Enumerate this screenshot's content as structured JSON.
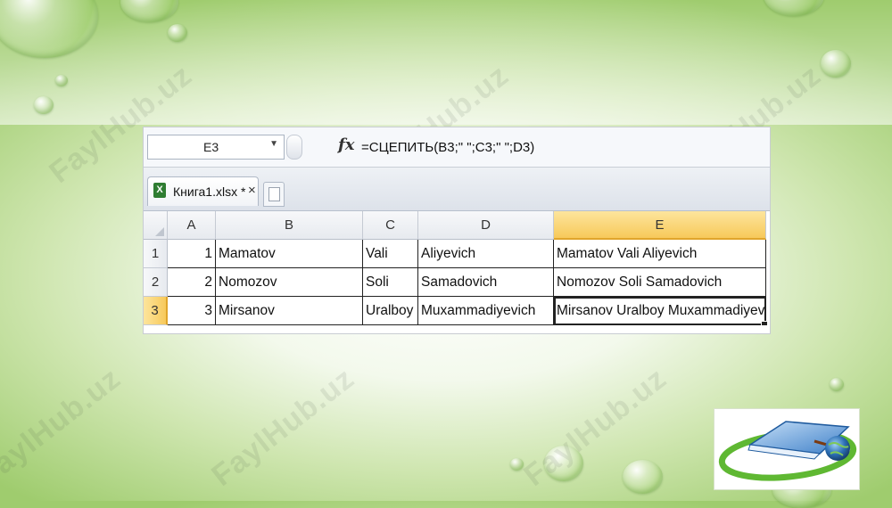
{
  "watermark": "FaylHub.uz",
  "excel": {
    "namebox": "E3",
    "fx_label": "fx",
    "formula": "=СЦЕПИТЬ(B3;\" \";C3;\" \";D3)",
    "tab": {
      "icon": "excel-file-icon",
      "label": "Книга1.xlsx *",
      "close": "×"
    },
    "columns": [
      "A",
      "B",
      "C",
      "D",
      "E"
    ],
    "rows": [
      {
        "num": "1",
        "a": "1",
        "b": "Mamatov",
        "c": "Vali",
        "d": "Aliyevich",
        "e": "Mamatov Vali Aliyevich"
      },
      {
        "num": "2",
        "a": "2",
        "b": "Nomozov",
        "c": "Soli",
        "d": "Samadovich",
        "e": "Nomozov Soli Samadovich"
      },
      {
        "num": "3",
        "a": "3",
        "b": "Mirsanov",
        "c": "Uralboy",
        "d": "Muxammadiyevich",
        "e": "Mirsanov Uralboy Muxammadiyevich"
      }
    ],
    "active_column": "E",
    "active_row": "3"
  },
  "colors": {
    "accent_green": "#9fcc6e",
    "active_header": "#f7c95a"
  }
}
